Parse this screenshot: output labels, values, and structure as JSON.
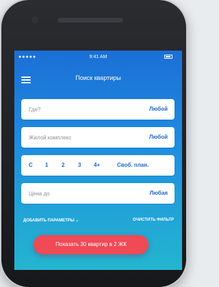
{
  "status": {
    "signal": "●●●●● ",
    "time": "9:41 AM"
  },
  "header": {
    "title": "Поиск квартиры"
  },
  "form": {
    "location": {
      "placeholder": "Где?",
      "value": "Любой"
    },
    "complex": {
      "placeholder": "Жилой комплекс",
      "value": "Любой"
    },
    "rooms": [
      "С",
      "1",
      "2",
      "3",
      "4+",
      "Своб. план."
    ],
    "price": {
      "placeholder": "Цена до",
      "value": "Любая"
    }
  },
  "links": {
    "add": "ДОБАВИТЬ ПАРАМЕТРЫ ⌄",
    "clear": "ОЧИСТИТЬ ФИЛЬТР"
  },
  "cta": {
    "label": "Показать 30 квартир в 2 ЖК"
  },
  "colors": {
    "accent": "#1e66c6",
    "button": "#ef4a56",
    "gradient_top": "#1b6fd6",
    "gradient_bottom": "#23b6cf"
  }
}
